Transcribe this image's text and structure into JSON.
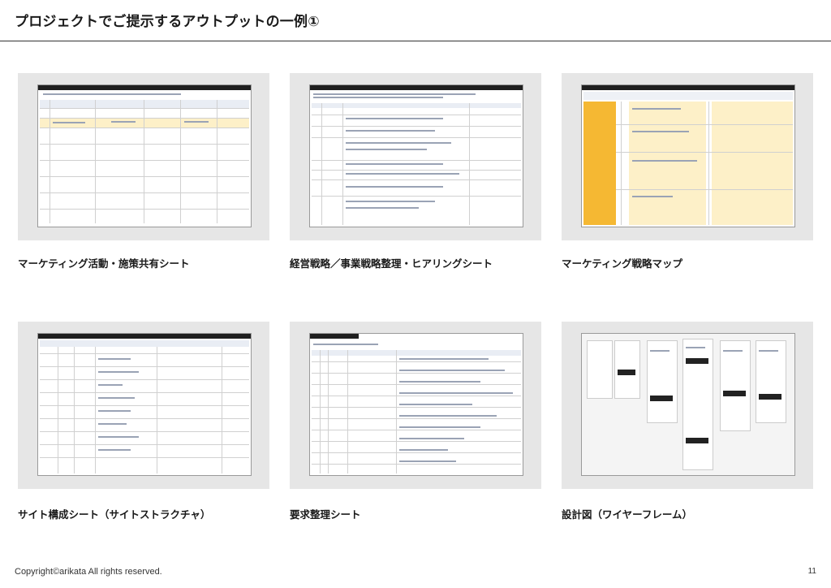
{
  "page": {
    "title": "プロジェクトでご提示するアウトプットの一例①",
    "footer": "Copyright©arikata All rights reserved.",
    "page_number": "11"
  },
  "cards": [
    {
      "caption": "マーケティング活動・施策共有シート"
    },
    {
      "caption": "経営戦略／事業戦略整理・ヒアリングシート"
    },
    {
      "caption": "マーケティング戦略マップ"
    },
    {
      "caption": "サイト構成シート（サイトストラクチャ）"
    },
    {
      "caption": "要求整理シート"
    },
    {
      "caption": "設計図（ワイヤーフレーム）"
    }
  ],
  "colors": {
    "card_bg": "#e6e6e6",
    "sheet_header": "#1f1f1f",
    "highlight_yellow": "#fdf0c8",
    "orange": "#f5b833"
  }
}
